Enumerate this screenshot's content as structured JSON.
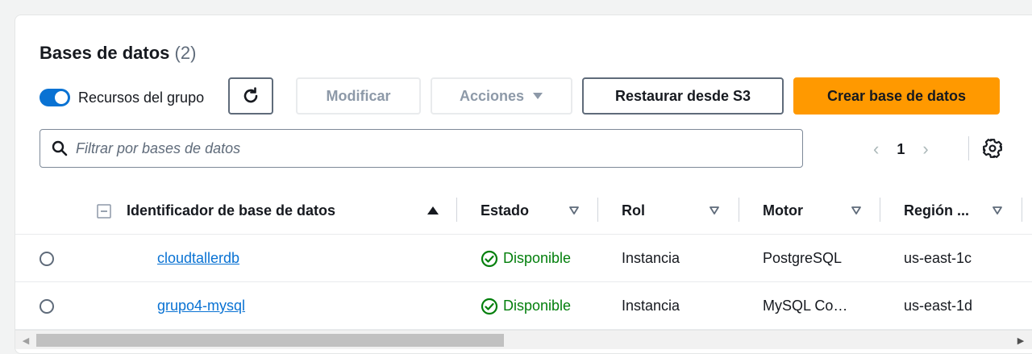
{
  "header": {
    "title": "Bases de datos",
    "count": "(2)"
  },
  "toolbar": {
    "toggle_label": "Recursos del grupo",
    "toggle_on": true,
    "modify_label": "Modificar",
    "actions_label": "Acciones",
    "restore_label": "Restaurar desde S3",
    "create_label": "Crear base de datos"
  },
  "filter": {
    "placeholder": "Filtrar por bases de datos",
    "value": ""
  },
  "pagination": {
    "current_page": "1"
  },
  "table": {
    "columns": [
      {
        "label": "Identificador de base de datos"
      },
      {
        "label": "Estado"
      },
      {
        "label": "Rol"
      },
      {
        "label": "Motor"
      },
      {
        "label": "Región ..."
      }
    ],
    "rows": [
      {
        "identifier": "cloudtallerdb",
        "status": "Disponible",
        "role": "Instancia",
        "engine": "PostgreSQL",
        "region": "us-east-1c"
      },
      {
        "identifier": "grupo4-mysql",
        "status": "Disponible",
        "role": "Instancia",
        "engine": "MySQL Co…",
        "region": "us-east-1d"
      }
    ]
  },
  "colors": {
    "primary": "#ff9900",
    "toggle": "#0972d3",
    "link": "#0972d3",
    "success": "#037f0c"
  }
}
